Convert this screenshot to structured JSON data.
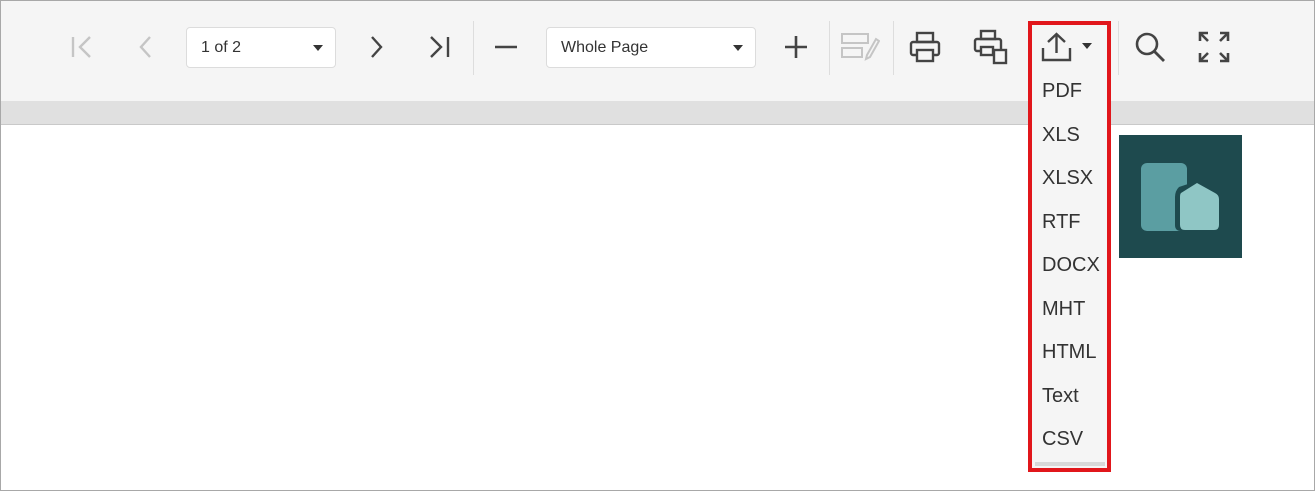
{
  "toolbar": {
    "page_selector": {
      "value": "1 of 2"
    },
    "zoom_selector": {
      "value": "Whole Page"
    }
  },
  "export_menu": {
    "items": [
      "PDF",
      "XLS",
      "XLSX",
      "RTF",
      "DOCX",
      "MHT",
      "HTML",
      "Text",
      "CSV"
    ]
  },
  "colors": {
    "toolbar_bg": "#f5f5f5",
    "highlight": "#e1161b",
    "logo_bg": "#1e4a4e",
    "logo_back": "#5b9ea2",
    "logo_front": "#8fc6c5"
  },
  "icons": {
    "first_page": "first-page-icon",
    "prev_page": "previous-page-icon",
    "next_page": "next-page-icon",
    "last_page": "last-page-icon",
    "zoom_out": "minus-icon",
    "zoom_in": "plus-icon",
    "edit_fields": "edit-fields-icon",
    "print": "print-icon",
    "print_page": "print-page-icon",
    "export": "export-upload-icon",
    "search": "search-icon",
    "fullscreen": "fullscreen-icon"
  }
}
